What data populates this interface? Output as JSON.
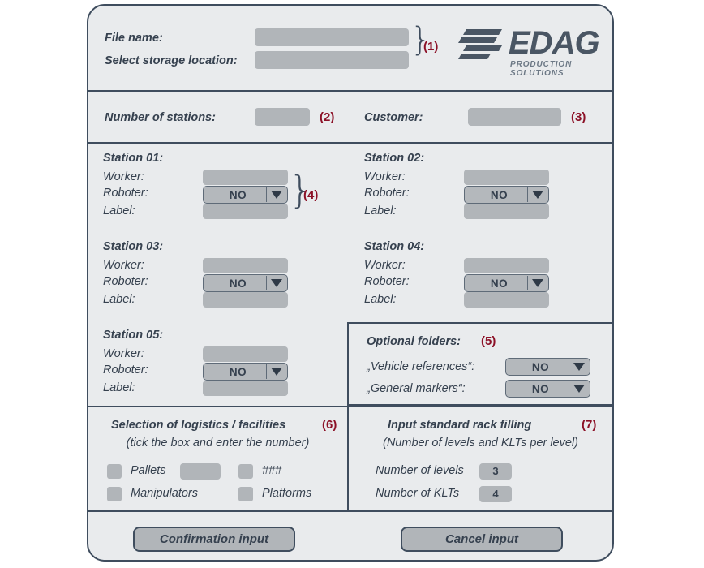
{
  "header": {
    "file_name_label": "File name:",
    "storage_label": "Select storage location:",
    "file_name_value": "",
    "storage_value": "",
    "annotation": "(1)",
    "logo": {
      "name": "EDAG",
      "tagline": "PRODUCTION SOLUTIONS",
      "mark": "edag-bars-icon"
    }
  },
  "meta": {
    "stations_label": "Number of stations:",
    "stations_value": "",
    "stations_annotation": "(2)",
    "customer_label": "Customer:",
    "customer_value": "",
    "customer_annotation": "(3)"
  },
  "station_fields": {
    "worker": "Worker:",
    "roboter": "Roboter:",
    "label": "Label:"
  },
  "stations": [
    {
      "title": "Station 01:",
      "worker_value": "",
      "roboter_value": "NO",
      "label_value": "",
      "annotation": "(4)"
    },
    {
      "title": "Station 02:",
      "worker_value": "",
      "roboter_value": "NO",
      "label_value": ""
    },
    {
      "title": "Station 03:",
      "worker_value": "",
      "roboter_value": "NO",
      "label_value": ""
    },
    {
      "title": "Station 04:",
      "worker_value": "",
      "roboter_value": "NO",
      "label_value": ""
    },
    {
      "title": "Station 05:",
      "worker_value": "",
      "roboter_value": "NO",
      "label_value": ""
    }
  ],
  "optional_folders": {
    "title": "Optional folders:",
    "annotation": "(5)",
    "rows": [
      {
        "label": "„Vehicle references“:",
        "value": "NO"
      },
      {
        "label": "„General markers“:",
        "value": "NO"
      }
    ]
  },
  "logistics": {
    "title": "Selection of logistics / facilities",
    "subtitle": "(tick the box and enter the number)",
    "annotation": "(6)",
    "items": [
      {
        "label": "Pallets",
        "checked": false,
        "number_value": ""
      },
      {
        "label": "###",
        "checked": false
      },
      {
        "label": "Manipulators",
        "checked": false
      },
      {
        "label": "Platforms",
        "checked": false
      }
    ]
  },
  "rack": {
    "title": "Input standard rack filling",
    "subtitle": "(Number of levels and KLTs per level)",
    "annotation": "(7)",
    "rows": [
      {
        "label": "Number of levels",
        "value": "3"
      },
      {
        "label": "Number of KLTs",
        "value": "4"
      }
    ]
  },
  "footer": {
    "confirm_label": "Confirmation input",
    "cancel_label": "Cancel input"
  },
  "colors": {
    "panel_bg": "#e9ebed",
    "border": "#3f4d5e",
    "field": "#b1b5b9",
    "annotation": "#8c1127",
    "text": "#36414f"
  }
}
